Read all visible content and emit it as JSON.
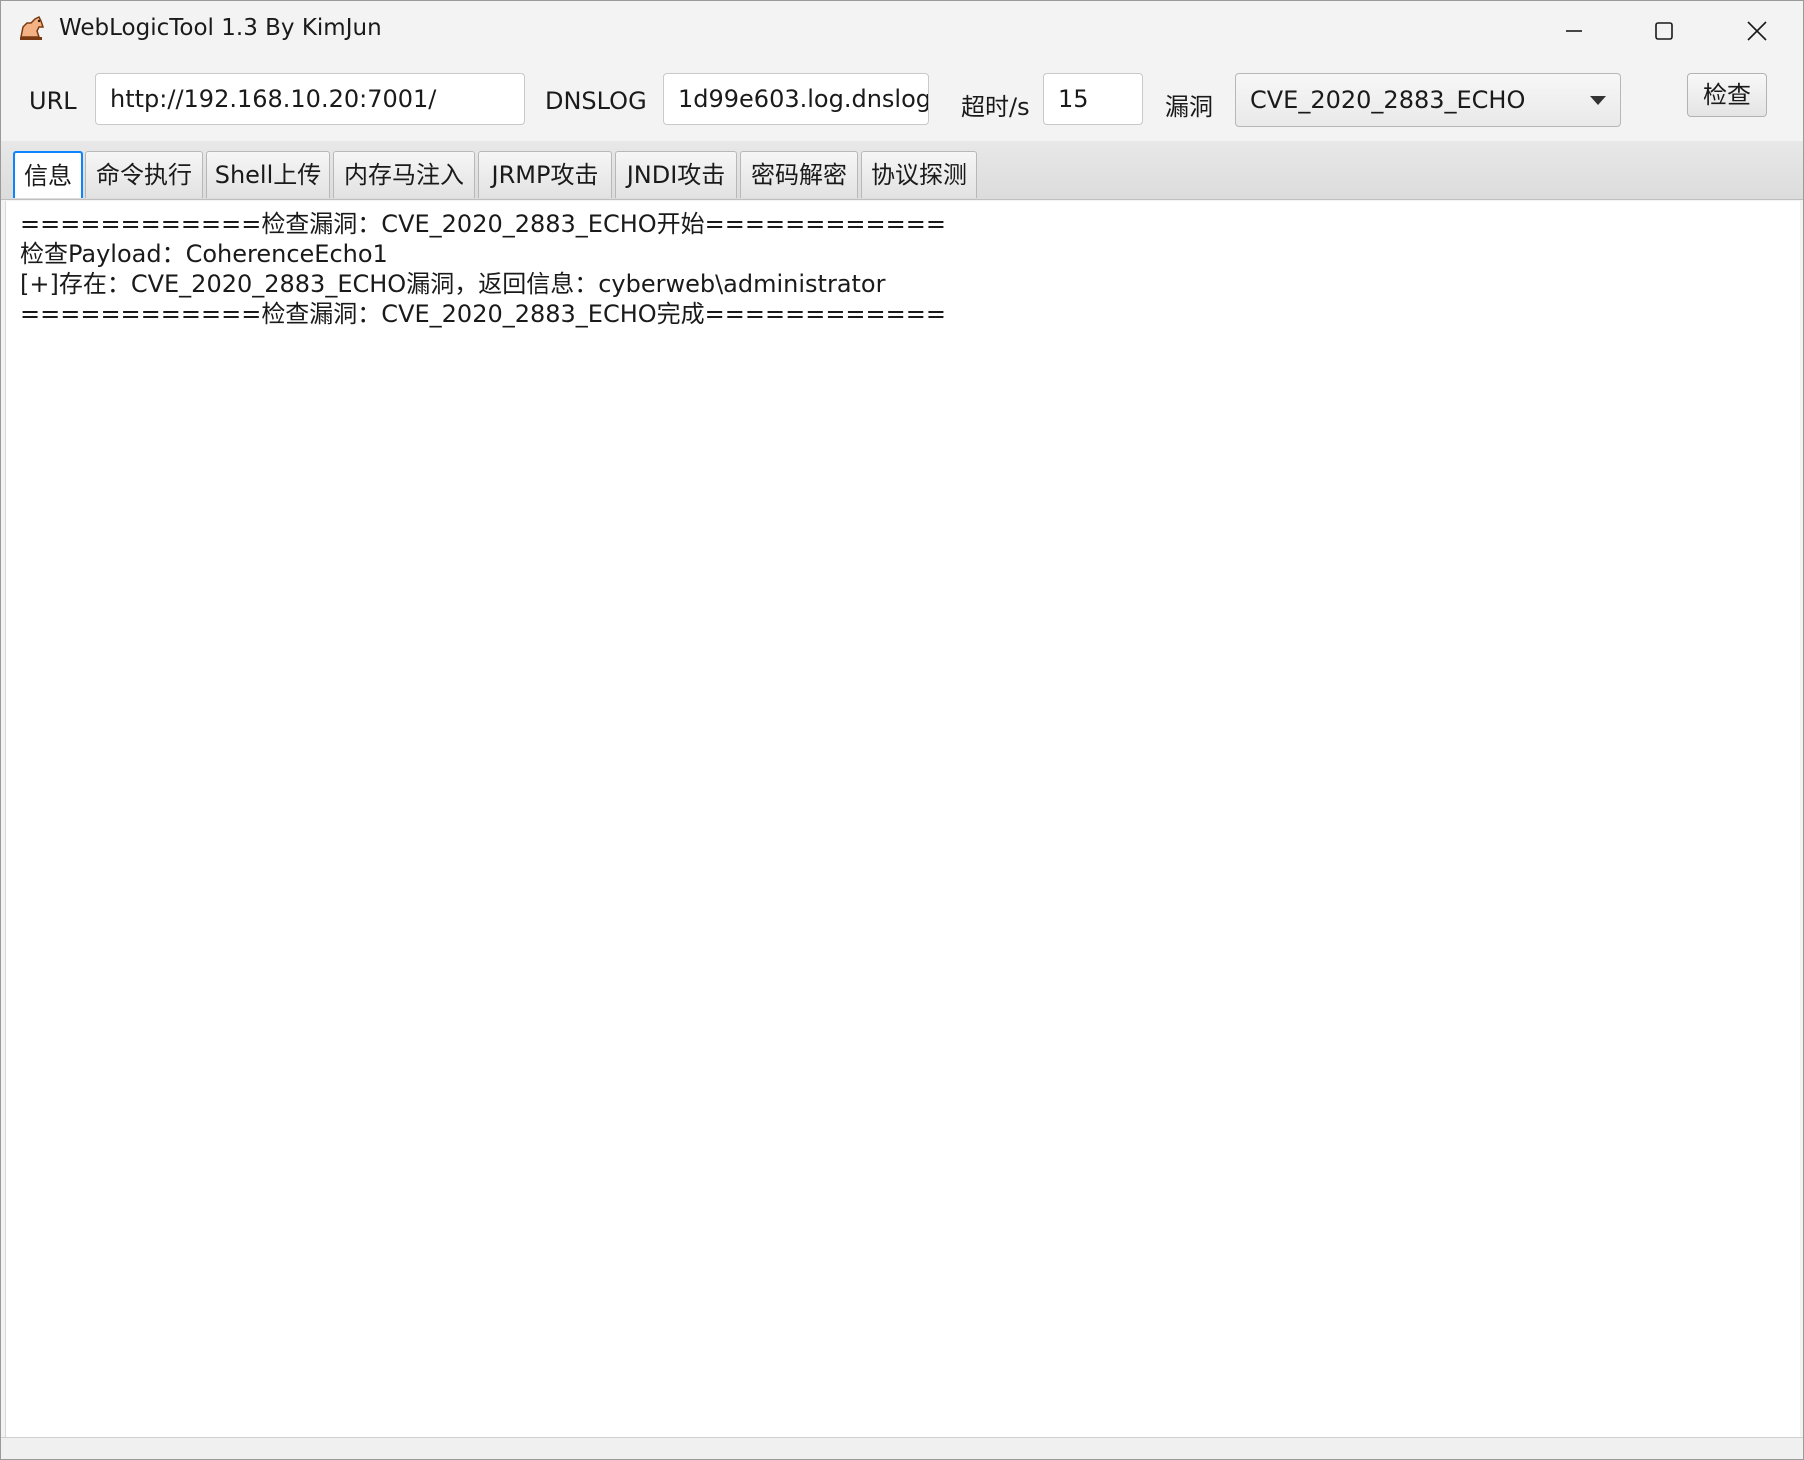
{
  "window": {
    "title": "WebLogicTool 1.3 By KimJun",
    "icon": "horse-app-icon"
  },
  "toolbar": {
    "url_label": "URL",
    "url_value": "http://192.168.10.20:7001/",
    "dnslog_label": "DNSLOG",
    "dnslog_value": "1d99e603.log.dnslog",
    "timeout_label": "超时/s",
    "timeout_value": "15",
    "vuln_label": "漏洞",
    "vuln_selected": "CVE_2020_2883_ECHO",
    "check_button": "检查"
  },
  "tabs": [
    {
      "label": "信息",
      "active": true
    },
    {
      "label": "命令执行",
      "active": false
    },
    {
      "label": "Shell上传",
      "active": false
    },
    {
      "label": "内存马注入",
      "active": false
    },
    {
      "label": "JRMP攻击",
      "active": false
    },
    {
      "label": "JNDI攻击",
      "active": false
    },
    {
      "label": "密码解密",
      "active": false
    },
    {
      "label": "协议探测",
      "active": false
    }
  ],
  "log": [
    "============检查漏洞：CVE_2020_2883_ECHO开始============",
    "检查Payload：CoherenceEcho1",
    "[+]存在：CVE_2020_2883_ECHO漏洞，返回信息：cyberweb\\administrator",
    "============检查漏洞：CVE_2020_2883_ECHO完成============"
  ],
  "colors": {
    "accent": "#0a84ff",
    "window_bg": "#f3f3f3"
  }
}
